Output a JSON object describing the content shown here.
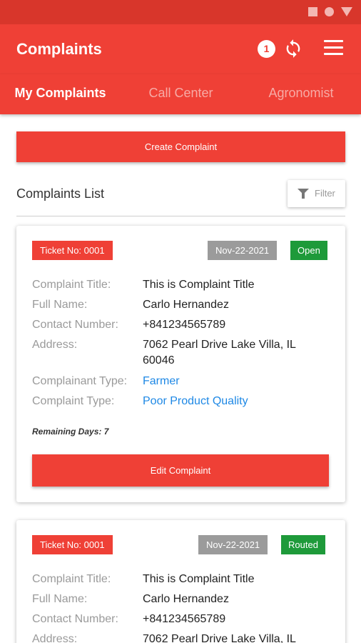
{
  "app": {
    "title": "Complaints",
    "notification_count": "1"
  },
  "tabs": [
    {
      "label": "My Complaints",
      "active": true
    },
    {
      "label": "Call Center",
      "active": false
    },
    {
      "label": "Agronomist",
      "active": false
    }
  ],
  "actions": {
    "create_label": "Create Complaint"
  },
  "list": {
    "title": "Complaints List",
    "filter_label": "Filter"
  },
  "labels": {
    "complaint_title": "Complaint Title:",
    "full_name": "Full Name:",
    "contact_number": "Contact Number:",
    "address": "Address:",
    "complainant_type": "Complainant Type:",
    "complaint_type": "Complaint Type:"
  },
  "complaints": [
    {
      "ticket": "Ticket No: 0001",
      "date": "Nov-22-2021",
      "status": "Open",
      "title": "This is Complaint Title",
      "full_name": "Carlo Hernandez",
      "contact": "+841234565789",
      "address": "7062 Pearl Drive Lake Villa, IL 60046",
      "complainant_type": "Farmer",
      "complaint_type": "Poor Product Quality",
      "remaining": "Remaining Days: 7",
      "edit_label": "Edit Complaint"
    },
    {
      "ticket": "Ticket No: 0001",
      "date": "Nov-22-2021",
      "status": "Routed",
      "title": "This is Complaint Title",
      "full_name": "Carlo Hernandez",
      "contact": "+841234565789",
      "address": "7062 Pearl Drive Lake Villa, IL"
    }
  ],
  "colors": {
    "primary": "#ef4036",
    "status_bar": "#d8362b",
    "open": "#1e9a3a",
    "date_chip": "#9b9b9b",
    "link": "#1e88e5"
  }
}
